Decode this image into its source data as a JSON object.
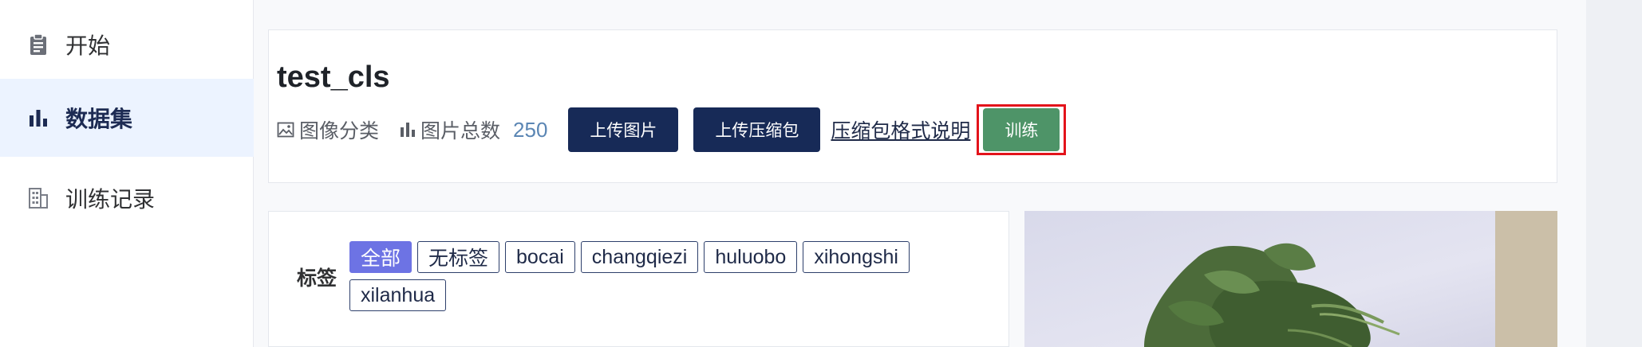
{
  "sidebar": {
    "items": [
      {
        "label": "开始",
        "icon": "clipboard-icon"
      },
      {
        "label": "数据集",
        "icon": "bar-chart-icon",
        "active": true
      },
      {
        "label": "训练记录",
        "icon": "building-icon"
      }
    ]
  },
  "dataset": {
    "title": "test_cls",
    "type_label": "图像分类",
    "total_label": "图片总数",
    "total_count": "250",
    "upload_images_label": "上传图片",
    "upload_zip_label": "上传压缩包",
    "format_link_label": "压缩包格式说明",
    "train_label": "训练"
  },
  "tags": {
    "label": "标签",
    "items": [
      "全部",
      "无标签",
      "bocai",
      "changqiezi",
      "huluobo",
      "xihongshi",
      "xilanhua"
    ],
    "active": "全部"
  },
  "preview": {
    "icon": "leafy-vegetable-photo"
  },
  "colors": {
    "primary": "#172a57",
    "train": "#4e9468",
    "highlight": "#e3131b",
    "tag_active": "#6d73e4",
    "count": "#5b86b4"
  }
}
